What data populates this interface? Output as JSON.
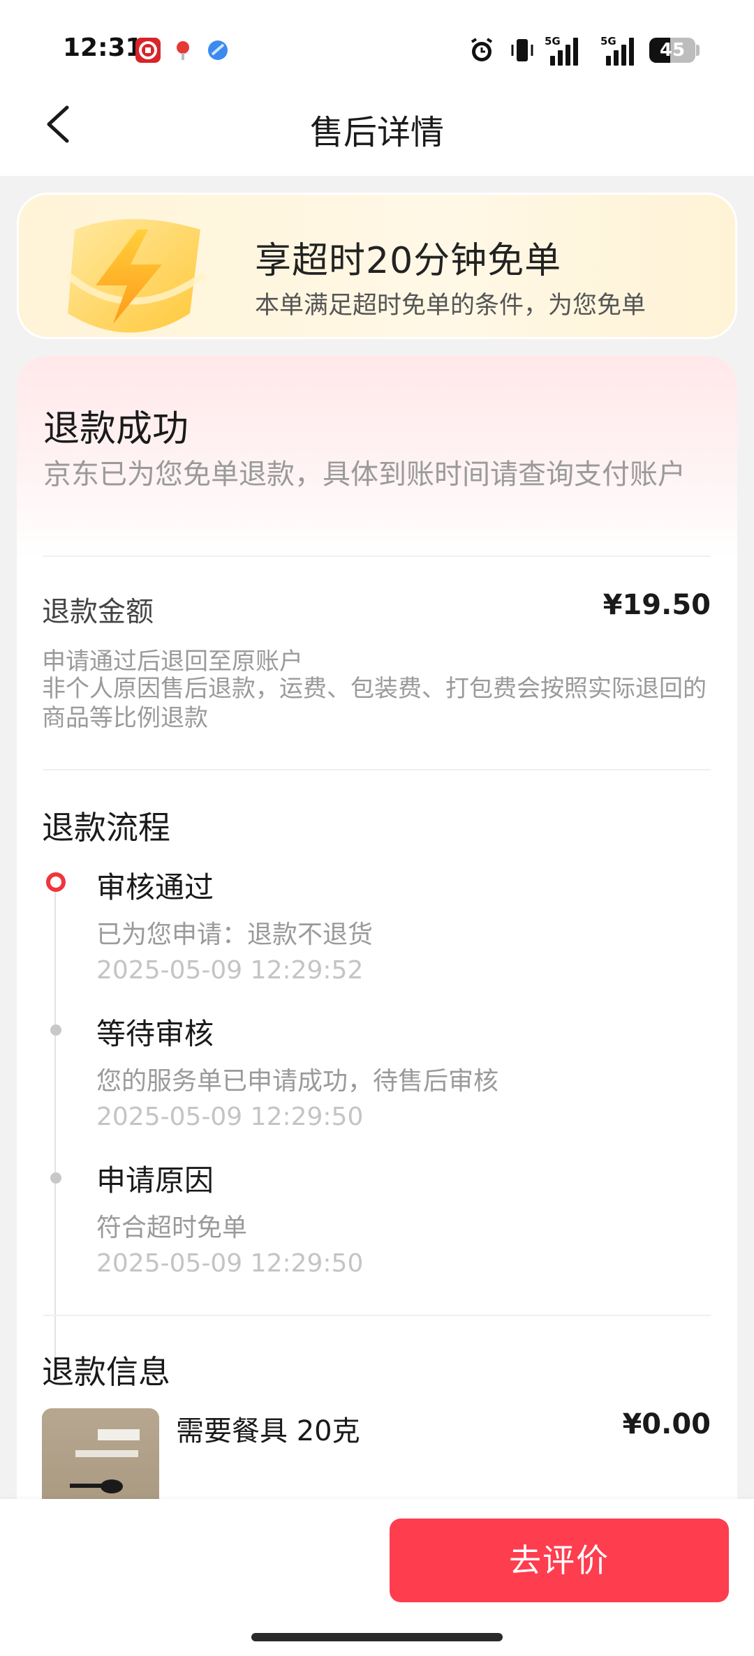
{
  "status_bar": {
    "time": "12:31",
    "network1": "5G",
    "network2": "5G",
    "battery_level": "45",
    "battery_fraction": 0.45
  },
  "header": {
    "title": "售后详情",
    "back_icon": "chevron-left-icon"
  },
  "promo": {
    "title": "享超时20分钟免单",
    "subtitle": "本单满足超时免单的条件，为您免单",
    "icon": "lightning-shield-icon"
  },
  "refund": {
    "status": "退款成功",
    "description": "京东已为您免单退款，具体到账时间请查询支付账户",
    "amount_label": "退款金额",
    "amount_value": "¥19.50",
    "note_line1": "申请通过后退回至原账户",
    "note_line2": "非个人原因售后退款，运费、包装费、打包费会按照实际退回的商品等比例退款"
  },
  "process": {
    "title": "退款流程",
    "steps": [
      {
        "title": "审核通过",
        "desc": "已为您申请：退款不退货",
        "time": "2025-05-09 12:29:52"
      },
      {
        "title": "等待审核",
        "desc": "您的服务单已申请成功，待售后审核",
        "time": "2025-05-09 12:29:50"
      },
      {
        "title": "申请原因",
        "desc": "符合超时免单",
        "time": "2025-05-09 12:29:50"
      }
    ]
  },
  "refund_info": {
    "title": "退款信息",
    "item_name": "需要餐具 20克",
    "item_price": "¥0.00"
  },
  "bottom": {
    "review_button": "去评价"
  },
  "colors": {
    "accent": "#fe3d4f",
    "active_dot": "#f0353d",
    "promo_bg": "#fff4d7",
    "card_head_bg": "#ffe8ea"
  }
}
